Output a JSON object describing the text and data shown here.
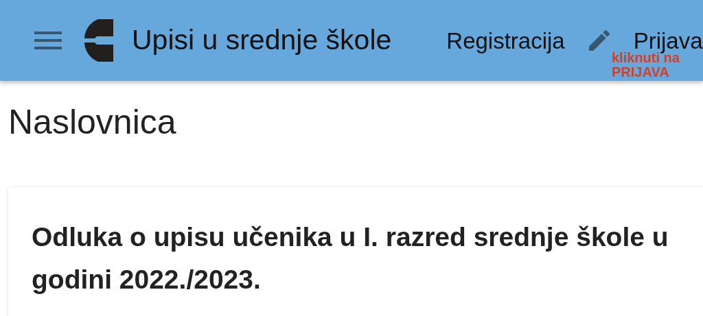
{
  "header": {
    "title": "Upisi u srednje škole",
    "nav": [
      {
        "label": "Registracija",
        "icon": false
      },
      {
        "label": "Prijava",
        "icon": true
      }
    ],
    "annotation": [
      "kliknuti na",
      "PRIJAVA"
    ]
  },
  "page_title": "Naslovnica",
  "card": {
    "heading_lines": [
      "Odluka o upisu učenika u I. razred srednje škole u",
      "godini 2022./2023."
    ]
  }
}
